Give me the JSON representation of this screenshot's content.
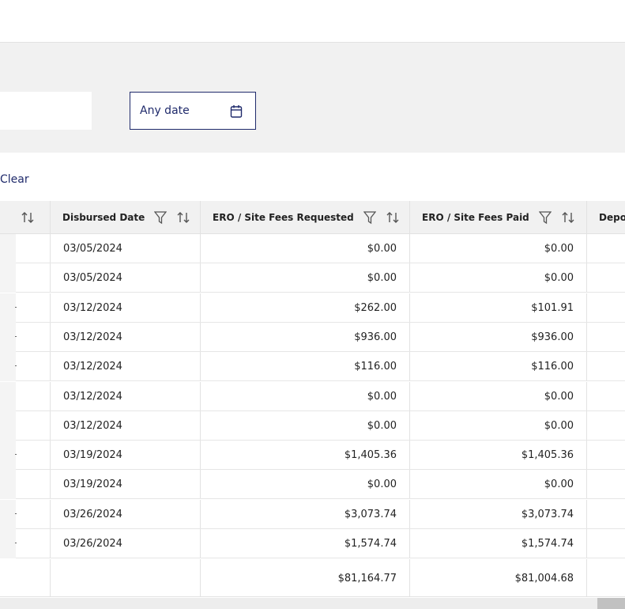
{
  "filters": {
    "date_picker": {
      "label": "Any date",
      "icon": "calendar-icon"
    },
    "clear_label": "Clear"
  },
  "table": {
    "columns": [
      {
        "label": "Disbursed Date",
        "filter_icon": "filter-icon",
        "sort_icon": "sort-icon"
      },
      {
        "label": "ERO / Site Fees Requested",
        "filter_icon": "filter-icon",
        "sort_icon": "sort-icon"
      },
      {
        "label": "ERO / Site Fees Paid",
        "filter_icon": "filter-icon",
        "sort_icon": "sort-icon"
      },
      {
        "label": "Depo"
      }
    ],
    "rows": [
      {
        "disbursed_date": "03/05/2024",
        "fees_requested": "$0.00",
        "fees_paid": "$0.00",
        "marker": false
      },
      {
        "disbursed_date": "03/05/2024",
        "fees_requested": "$0.00",
        "fees_paid": "$0.00",
        "marker": false
      },
      {
        "disbursed_date": "03/12/2024",
        "fees_requested": "$262.00",
        "fees_paid": "$101.91",
        "marker": true
      },
      {
        "disbursed_date": "03/12/2024",
        "fees_requested": "$936.00",
        "fees_paid": "$936.00",
        "marker": true
      },
      {
        "disbursed_date": "03/12/2024",
        "fees_requested": "$116.00",
        "fees_paid": "$116.00",
        "marker": true
      },
      {
        "disbursed_date": "03/12/2024",
        "fees_requested": "$0.00",
        "fees_paid": "$0.00",
        "marker": false
      },
      {
        "disbursed_date": "03/12/2024",
        "fees_requested": "$0.00",
        "fees_paid": "$0.00",
        "marker": false
      },
      {
        "disbursed_date": "03/19/2024",
        "fees_requested": "$1,405.36",
        "fees_paid": "$1,405.36",
        "marker": true
      },
      {
        "disbursed_date": "03/19/2024",
        "fees_requested": "$0.00",
        "fees_paid": "$0.00",
        "marker": false
      },
      {
        "disbursed_date": "03/26/2024",
        "fees_requested": "$3,073.74",
        "fees_paid": "$3,073.74",
        "marker": true
      },
      {
        "disbursed_date": "03/26/2024",
        "fees_requested": "$1,574.74",
        "fees_paid": "$1,574.74",
        "marker": true
      }
    ],
    "totals": {
      "fees_requested": "$81,164.77",
      "fees_paid": "$81,004.68"
    }
  },
  "colors": {
    "accent": "#1f2a6b",
    "panel_bg": "#f1f1f1",
    "border": "#e2e2e2"
  }
}
